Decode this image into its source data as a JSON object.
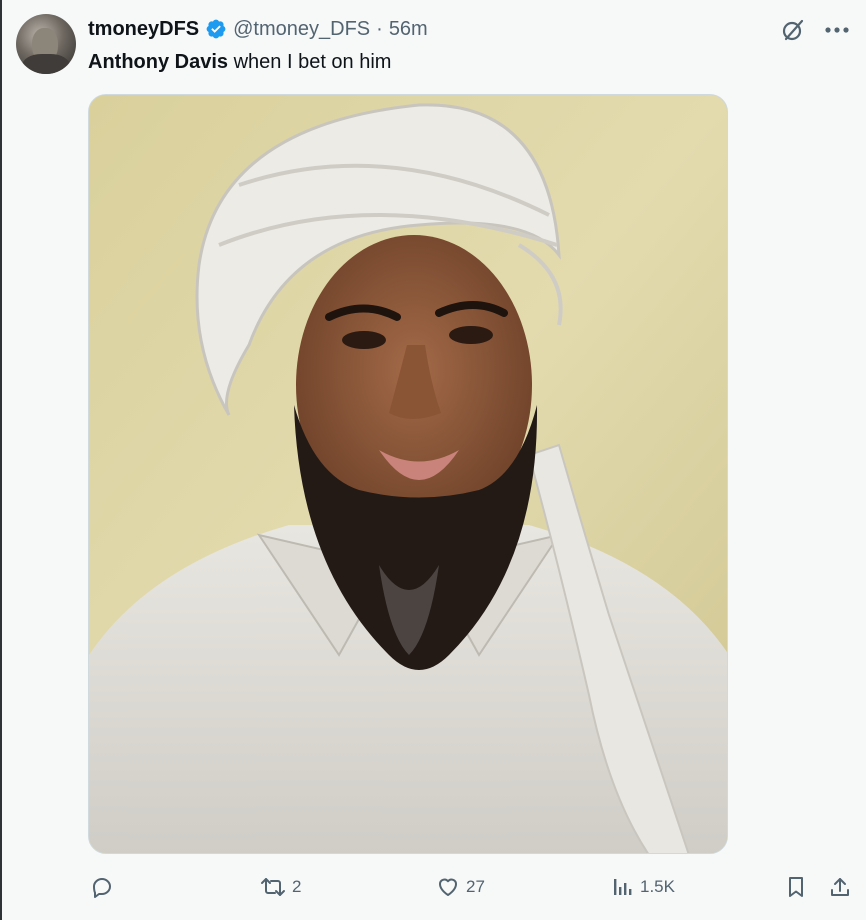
{
  "author": {
    "display_name": "tmoneyDFS",
    "handle": "@tmoney_DFS",
    "separator": "·",
    "time": "56m",
    "avatar_icon": "profile-photo"
  },
  "tweet": {
    "text_bold": "Anthony Davis",
    "text_rest": " when I bet on him"
  },
  "media": {
    "description_icon": "photo"
  },
  "actions": {
    "reply": {
      "icon": "reply-icon",
      "count": ""
    },
    "retweet": {
      "icon": "retweet-icon",
      "count": "2"
    },
    "like": {
      "icon": "heart-icon",
      "count": "27"
    },
    "views": {
      "icon": "analytics-icon",
      "count": "1.5K"
    },
    "bookmark": {
      "icon": "bookmark-icon"
    },
    "share": {
      "icon": "share-icon"
    }
  },
  "colors": {
    "verified": "#1d9bf0",
    "text_primary": "#0f1419",
    "text_secondary": "#536471"
  }
}
